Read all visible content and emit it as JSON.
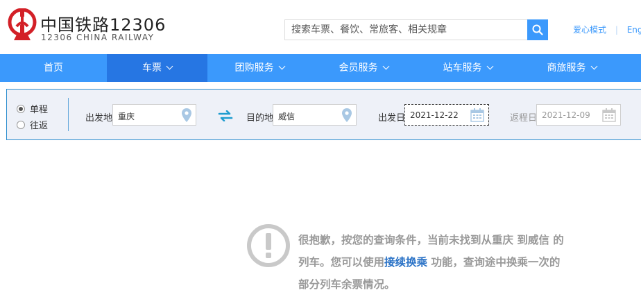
{
  "header": {
    "brand_cn": "中国铁路12306",
    "brand_en": "12306 CHINA RAILWAY",
    "search_placeholder": "搜索车票、餐饮、常旅客、相关规章",
    "links": {
      "care_mode": "爱心模式",
      "english": "English"
    }
  },
  "nav": {
    "items": [
      {
        "label": "首页",
        "has_dropdown": false,
        "active": false
      },
      {
        "label": "车票",
        "has_dropdown": true,
        "active": true
      },
      {
        "label": "团购服务",
        "has_dropdown": true,
        "active": false
      },
      {
        "label": "会员服务",
        "has_dropdown": true,
        "active": false
      },
      {
        "label": "站车服务",
        "has_dropdown": true,
        "active": false
      },
      {
        "label": "商旅服务",
        "has_dropdown": true,
        "active": false
      }
    ]
  },
  "query": {
    "trip_types": [
      {
        "label": "单程",
        "checked": true
      },
      {
        "label": "往返",
        "checked": false
      }
    ],
    "from": {
      "label": "出发地",
      "value": "重庆"
    },
    "to": {
      "label": "目的地",
      "value": "威信"
    },
    "depart": {
      "label": "出发日",
      "value": "2021-12-22"
    },
    "return": {
      "label": "返程日",
      "value": "2021-12-09"
    }
  },
  "message": {
    "line1": "很抱歉，按您的查询条件，当前未找到从重庆 到威信 的",
    "line2_before": "列车。您可以使用",
    "line2_link": "接续换乘",
    "line2_after": " 功能，查询途中换乘一次的",
    "line3": "部分列车余票情况。"
  },
  "colors": {
    "brand_red": "#d32027",
    "nav_blue": "#3b99fc",
    "nav_active": "#2676e3",
    "query_border": "#298cce",
    "link_blue": "#2a72c6",
    "message_gray": "#999999"
  }
}
